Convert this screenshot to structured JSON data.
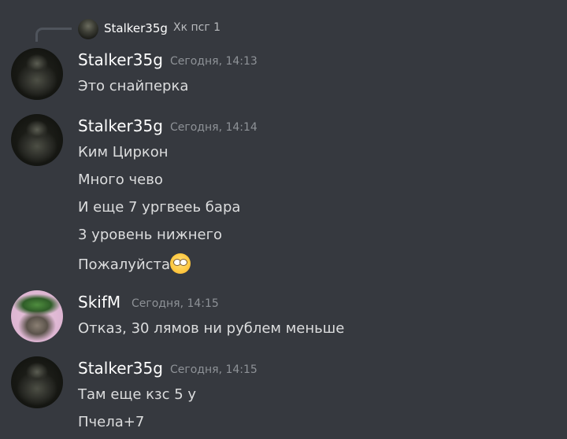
{
  "reply": {
    "author": "Stalker35g",
    "text": "Хк псг 1"
  },
  "messages": [
    {
      "author": "Stalker35g",
      "timestamp": "Сегодня, 14:13",
      "lines": [
        "Это снайперка"
      ],
      "avatar": "stalker-avatar"
    },
    {
      "author": "Stalker35g",
      "timestamp": "Сегодня, 14:14",
      "lines": [
        "Ким  Циркон",
        "Много чево",
        "И еще 7 ургвееь бара",
        "3 уровень нижнего",
        "Пожалуйста"
      ],
      "avatar": "stalker-avatar",
      "emoji": "face-with-rolling-eyes"
    },
    {
      "author": "SkifM",
      "timestamp": "Сегодня, 14:15",
      "lines": [
        "Отказ, 30 лямов ни рублем меньше"
      ],
      "avatar": "cat-watermelon-avatar"
    },
    {
      "author": "Stalker35g",
      "timestamp": "Сегодня, 14:15",
      "lines": [
        "Там еще кзс 5 у",
        "Пчела+7"
      ],
      "avatar": "stalker-avatar"
    }
  ],
  "colors": {
    "background": "#36393f",
    "author": "#ffffff",
    "timestamp": "#8e9297",
    "text": "#dcddde",
    "reply_line": "#4f545c"
  }
}
